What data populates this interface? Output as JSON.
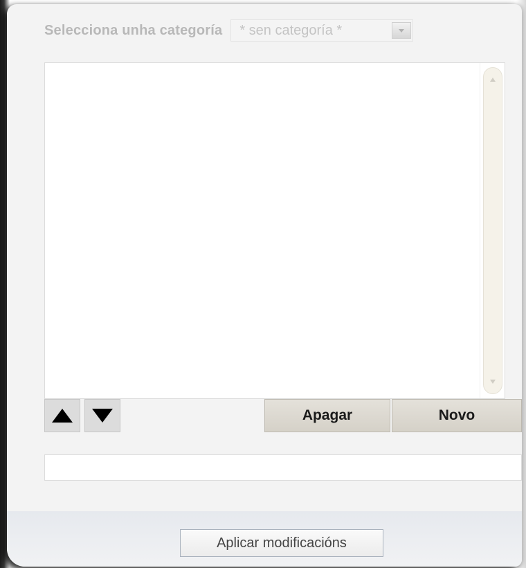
{
  "category": {
    "label": "Selecciona unha categoría",
    "selected": "* sen categoría *"
  },
  "list": {
    "items": []
  },
  "controls": {
    "delete_label": "Apagar",
    "new_label": "Novo"
  },
  "name_field": {
    "value": ""
  },
  "footer": {
    "apply_label": "Aplicar modificacións"
  },
  "icons": {
    "move_up": "triangle-up-icon",
    "move_down": "triangle-down-icon",
    "select_arrow": "chevron-down-icon"
  }
}
